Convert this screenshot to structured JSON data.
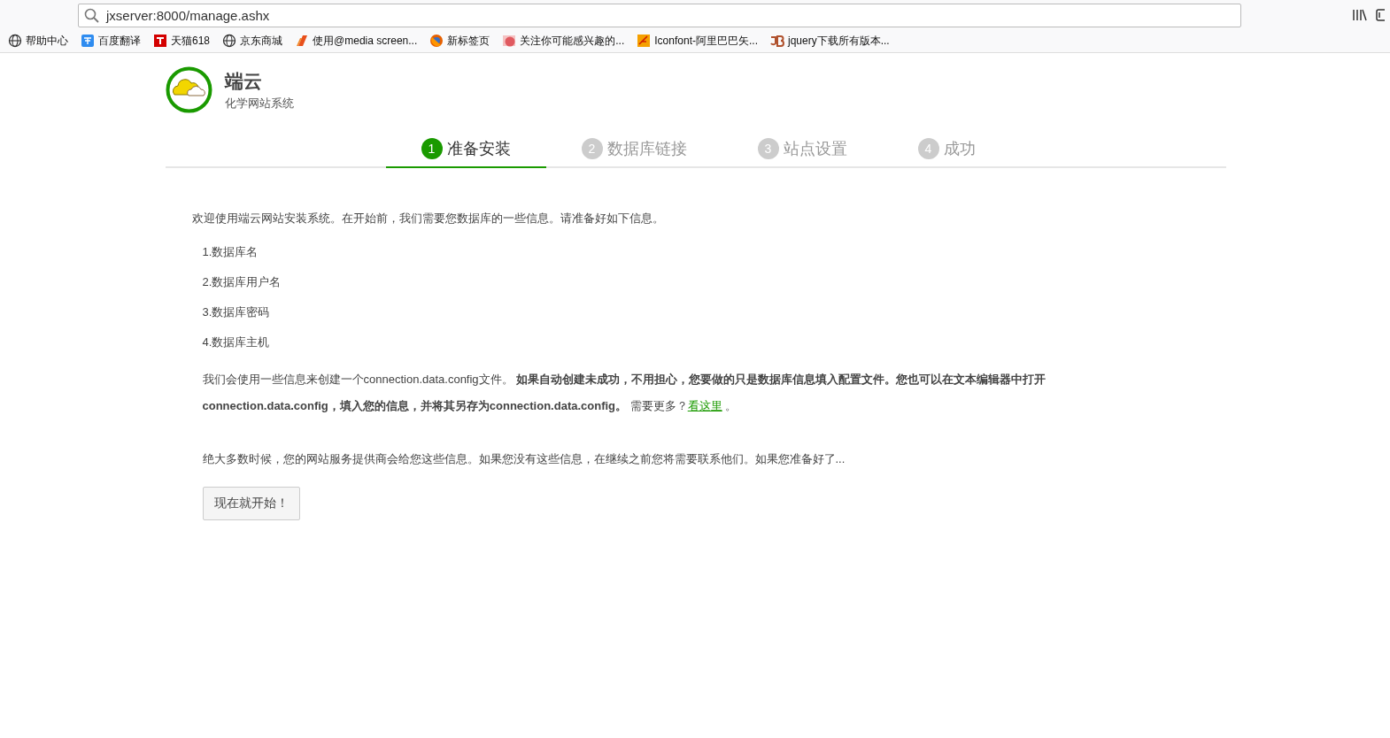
{
  "browser": {
    "address": "jxserver:8000/manage.ashx",
    "bookmarks": [
      {
        "kind": "globe",
        "label": "帮助中心"
      },
      {
        "kind": "translate",
        "label": "百度翻译"
      },
      {
        "kind": "tmall",
        "label": "天猫618"
      },
      {
        "kind": "globe",
        "label": "京东商城"
      },
      {
        "kind": "slash",
        "label": "使用@media screen..."
      },
      {
        "kind": "firefox",
        "label": "新标签页"
      },
      {
        "kind": "blob",
        "label": "关注你可能感兴趣的..."
      },
      {
        "kind": "iconfont",
        "label": "Iconfont-阿里巴巴矢..."
      },
      {
        "kind": "jb",
        "label": "jquery下载所有版本..."
      }
    ]
  },
  "brand": {
    "title": "端云",
    "subtitle": "化学网站系统"
  },
  "steps": [
    {
      "number": "1",
      "label": "准备安装",
      "selected": true
    },
    {
      "number": "2",
      "label": "数据库链接",
      "selected": false
    },
    {
      "number": "3",
      "label": "站点设置",
      "selected": false
    },
    {
      "number": "4",
      "label": "成功",
      "selected": false
    }
  ],
  "intro": "欢迎使用端云网站安装系统。在开始前，我们需要您数据库的一些信息。请准备好如下信息。",
  "requirements": [
    "1.数据库名",
    "2.数据库用户名",
    "3.数据库密码",
    "4.数据库主机"
  ],
  "config_note": {
    "text": "我们会使用一些信息来创建一个connection.data.config文件。 **如果自动创建未成功，不用担心，您要做的只是数据库信息填入配置文件。您也可以在文本编辑器中打开connection.data.config，填入您的信息，并将其另存为connection.data.config。** 需要更多？",
    "link": "看这里",
    "after": " 。"
  },
  "closing": "绝大多数时候，您的网站服务提供商会给您这些信息。如果您没有这些信息，在继续之前您将需要联系他们。如果您准备好了...",
  "start_button": "现在就开始！"
}
